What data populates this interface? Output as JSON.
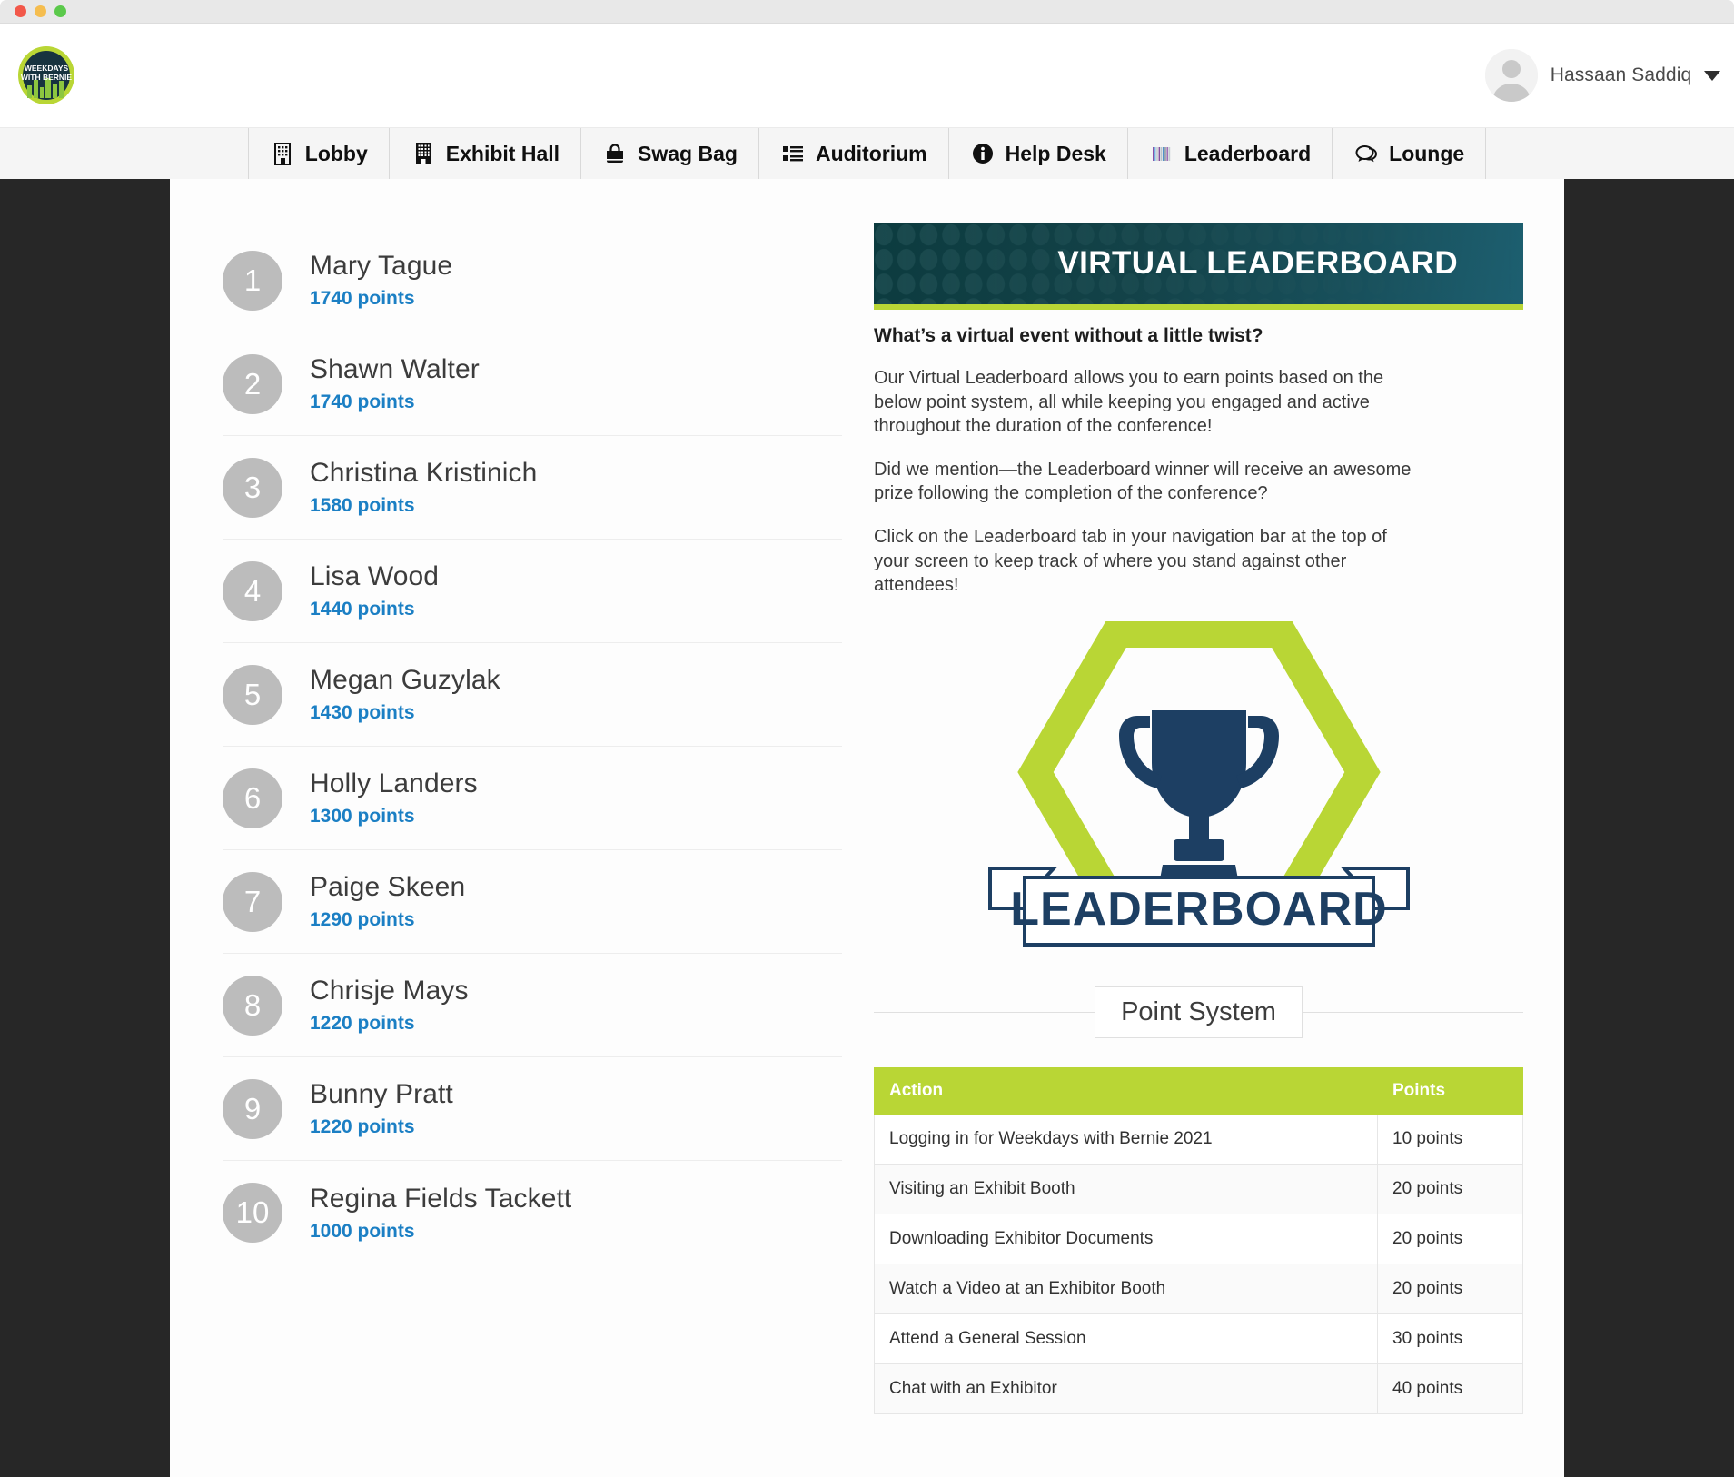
{
  "window": {
    "traffic_lights": [
      "close",
      "minimize",
      "zoom"
    ]
  },
  "header": {
    "logo_line1": "WEEKDAYS",
    "logo_line2": "WITH BERNIE",
    "user_name": "Hassaan Saddiq"
  },
  "nav": {
    "items": [
      {
        "label": "Lobby",
        "icon": "building-icon"
      },
      {
        "label": "Exhibit Hall",
        "icon": "office-building-icon"
      },
      {
        "label": "Swag Bag",
        "icon": "shopping-bag-icon"
      },
      {
        "label": "Auditorium",
        "icon": "list-grid-icon"
      },
      {
        "label": "Help Desk",
        "icon": "info-circle-icon"
      },
      {
        "label": "Leaderboard",
        "icon": "barcode-chart-icon"
      },
      {
        "label": "Lounge",
        "icon": "chat-bubbles-icon"
      }
    ]
  },
  "leaderboard": {
    "entries": [
      {
        "rank": "1",
        "name": "Mary Tague",
        "points": "1740 points"
      },
      {
        "rank": "2",
        "name": "Shawn Walter",
        "points": "1740 points"
      },
      {
        "rank": "3",
        "name": "Christina Kristinich",
        "points": "1580 points"
      },
      {
        "rank": "4",
        "name": "Lisa Wood",
        "points": "1440 points"
      },
      {
        "rank": "5",
        "name": "Megan Guzylak",
        "points": "1430 points"
      },
      {
        "rank": "6",
        "name": "Holly Landers",
        "points": "1300 points"
      },
      {
        "rank": "7",
        "name": "Paige Skeen",
        "points": "1290 points"
      },
      {
        "rank": "8",
        "name": "Chrisje Mays",
        "points": "1220 points"
      },
      {
        "rank": "9",
        "name": "Bunny Pratt",
        "points": "1220 points"
      },
      {
        "rank": "10",
        "name": "Regina Fields Tackett",
        "points": "1000 points"
      }
    ]
  },
  "info": {
    "banner_title": "VIRTUAL LEADERBOARD",
    "lede": "What’s a virtual event without a little twist?",
    "paragraph_1": "Our Virtual Leaderboard allows you to earn points based on the below point system, all while keeping you engaged and active throughout the duration of the conference!",
    "paragraph_2": "Did we mention—the Leaderboard winner will receive an awesome prize following the completion of the conference?",
    "paragraph_3": "Click on the Leaderboard tab in your navigation bar at the top of your screen to keep track of where you stand against other attendees!",
    "badge_ribbon_text": "LEADERBOARD",
    "section_title": "Point System"
  },
  "point_system": {
    "columns": [
      "Action",
      "Points"
    ],
    "rows": [
      {
        "action": "Logging in for Weekdays with Bernie 2021",
        "points": "10 points"
      },
      {
        "action": "Visiting an Exhibit Booth",
        "points": "20 points"
      },
      {
        "action": "Downloading Exhibitor Documents",
        "points": "20 points"
      },
      {
        "action": "Watch a Video at an Exhibitor Booth",
        "points": "20 points"
      },
      {
        "action": "Attend a General Session",
        "points": "30 points"
      },
      {
        "action": "Chat with an Exhibitor",
        "points": "40 points"
      }
    ]
  },
  "colors": {
    "brand_green": "#b9d635",
    "brand_navy": "#1d3f63",
    "points_blue": "#1b7fc4",
    "page_backdrop": "#272727",
    "rank_badge_gray": "#bcbcbc"
  }
}
